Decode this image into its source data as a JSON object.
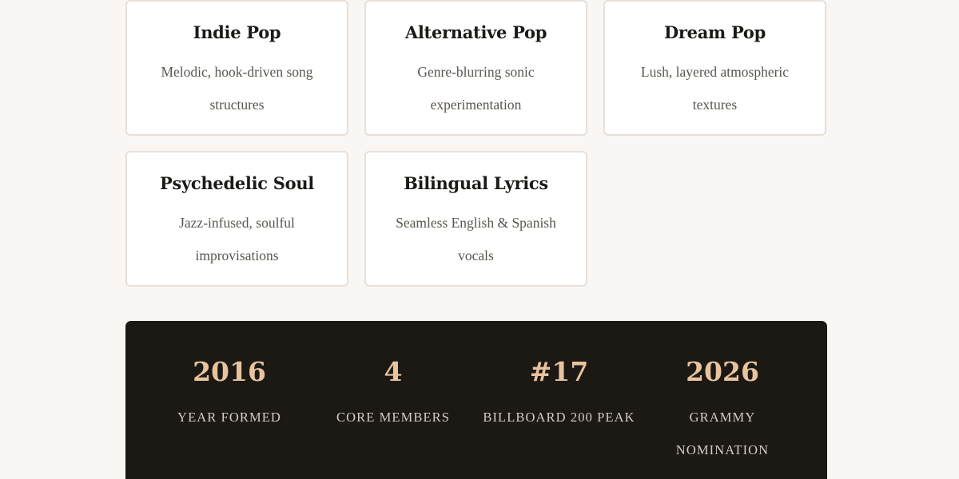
{
  "genres": [
    {
      "title": "Indie Pop",
      "description": "Melodic, hook-driven song structures"
    },
    {
      "title": "Alternative Pop",
      "description": "Genre-blurring sonic experimentation"
    },
    {
      "title": "Dream Pop",
      "description": "Lush, layered atmospheric textures"
    },
    {
      "title": "Psychedelic Soul",
      "description": "Jazz-infused, soulful improvisations"
    },
    {
      "title": "Bilingual Lyrics",
      "description": "Seamless English & Spanish vocals"
    }
  ],
  "stats": [
    {
      "value": "2016",
      "label": "YEAR FORMED"
    },
    {
      "value": "4",
      "label": "CORE MEMBERS"
    },
    {
      "value": "#17",
      "label": "BILLBOARD 200 PEAK"
    },
    {
      "value": "2026",
      "label": "GRAMMY NOMINATION"
    }
  ],
  "colors": {
    "page_background": "#faf6f3",
    "card_background": "#ffffff",
    "card_border": "#e7e0da",
    "stats_background": "#1c1915",
    "stat_value": "#e8c39e",
    "stat_label": "#d3cdc6"
  }
}
